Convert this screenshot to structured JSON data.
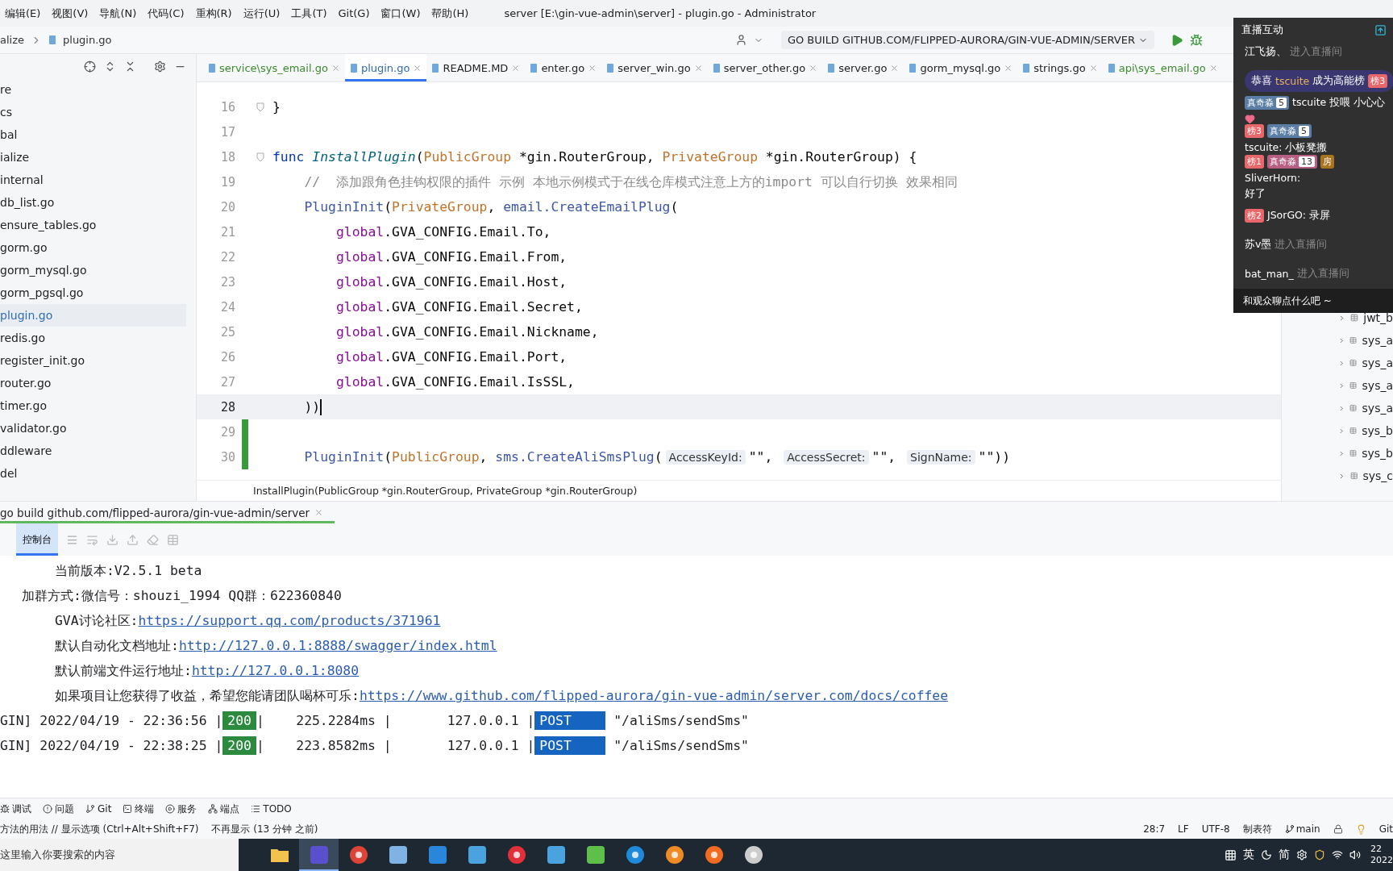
{
  "menu": [
    "编辑(E)",
    "视图(V)",
    "导航(N)",
    "代码(C)",
    "重构(R)",
    "运行(U)",
    "工具(T)",
    "Git(G)",
    "窗口(W)",
    "帮助(H)"
  ],
  "window": {
    "title": "server [E:\\gin-vue-admin\\server] - plugin.go - Administrator"
  },
  "breadcrumb": [
    "alize",
    "plugin.go"
  ],
  "run_config": "GO BUILD GITHUB.COM/FLIPPED-AURORA/GIN-VUE-ADMIN/SERVER",
  "project_tree": [
    {
      "label": "re",
      "selected": false
    },
    {
      "label": "cs",
      "selected": false
    },
    {
      "label": "bal",
      "selected": false
    },
    {
      "label": "ialize",
      "selected": false
    },
    {
      "label": "internal",
      "selected": false
    },
    {
      "label": "db_list.go",
      "selected": false
    },
    {
      "label": "ensure_tables.go",
      "selected": false
    },
    {
      "label": "gorm.go",
      "selected": false
    },
    {
      "label": "gorm_mysql.go",
      "selected": false
    },
    {
      "label": "gorm_pgsql.go",
      "selected": false
    },
    {
      "label": "plugin.go",
      "selected": true
    },
    {
      "label": "redis.go",
      "selected": false
    },
    {
      "label": "register_init.go",
      "selected": false
    },
    {
      "label": "router.go",
      "selected": false
    },
    {
      "label": "timer.go",
      "selected": false
    },
    {
      "label": "validator.go",
      "selected": false
    },
    {
      "label": "ddleware",
      "selected": false
    },
    {
      "label": "del",
      "selected": false
    }
  ],
  "editor_tabs": [
    {
      "label": "service\\sys_email.go",
      "selected": false,
      "modified": true
    },
    {
      "label": "plugin.go",
      "selected": true,
      "modified": false
    },
    {
      "label": "README.MD",
      "selected": false,
      "modified": false
    },
    {
      "label": "enter.go",
      "selected": false,
      "modified": false
    },
    {
      "label": "server_win.go",
      "selected": false,
      "modified": false
    },
    {
      "label": "server_other.go",
      "selected": false,
      "modified": false
    },
    {
      "label": "server.go",
      "selected": false,
      "modified": false
    },
    {
      "label": "gorm_mysql.go",
      "selected": false,
      "modified": false
    },
    {
      "label": "strings.go",
      "selected": false,
      "modified": false
    },
    {
      "label": "api\\sys_email.go",
      "selected": false,
      "modified": true
    }
  ],
  "code_lines": [
    {
      "number": "16",
      "current": false,
      "changed": false,
      "fold": true,
      "tokens": [
        {
          "kind": "plain",
          "text": "}"
        }
      ]
    },
    {
      "number": "17",
      "current": false,
      "changed": false,
      "fold": false
    },
    {
      "number": "18",
      "current": false,
      "changed": false,
      "fold": true,
      "tokens": [
        {
          "kind": "keyword",
          "text": "func "
        },
        {
          "kind": "declaration",
          "text": "InstallPlugin"
        },
        {
          "kind": "plain",
          "text": "("
        },
        {
          "kind": "param",
          "text": "PublicGroup"
        },
        {
          "kind": "plain",
          "text": " *gin.RouterGroup, "
        },
        {
          "kind": "param",
          "text": "PrivateGroup"
        },
        {
          "kind": "plain",
          "text": " *gin.RouterGroup) {"
        }
      ]
    },
    {
      "number": "19",
      "current": false,
      "changed": false,
      "fold": false,
      "tokens": [
        {
          "kind": "comment",
          "text": "    //  添加跟角色挂钩权限的插件 示例 本地示例模式于在线仓库模式注意上方的import 可以自行切换 效果相同"
        }
      ]
    },
    {
      "number": "20",
      "current": false,
      "changed": false,
      "fold": false,
      "tokens": [
        {
          "kind": "call",
          "text": "    PluginInit"
        },
        {
          "kind": "plain",
          "text": "("
        },
        {
          "kind": "param",
          "text": "PrivateGroup"
        },
        {
          "kind": "plain",
          "text": ", "
        },
        {
          "kind": "call",
          "text": "email.CreateEmailPlug"
        },
        {
          "kind": "plain",
          "text": "("
        }
      ]
    },
    {
      "number": "21",
      "current": false,
      "changed": false,
      "fold": false,
      "tokens": [
        {
          "kind": "global",
          "text": "        global"
        },
        {
          "kind": "plain",
          "text": ".GVA_CONFIG.Email.To,"
        }
      ]
    },
    {
      "number": "22",
      "current": false,
      "changed": false,
      "fold": false,
      "tokens": [
        {
          "kind": "global",
          "text": "        global"
        },
        {
          "kind": "plain",
          "text": ".GVA_CONFIG.Email.From,"
        }
      ]
    },
    {
      "number": "23",
      "current": false,
      "changed": false,
      "fold": false,
      "tokens": [
        {
          "kind": "global",
          "text": "        global"
        },
        {
          "kind": "plain",
          "text": ".GVA_CONFIG.Email.Host,"
        }
      ]
    },
    {
      "number": "24",
      "current": false,
      "changed": false,
      "fold": false,
      "tokens": [
        {
          "kind": "global",
          "text": "        global"
        },
        {
          "kind": "plain",
          "text": ".GVA_CONFIG.Email.Secret,"
        }
      ]
    },
    {
      "number": "25",
      "current": false,
      "changed": false,
      "fold": false,
      "tokens": [
        {
          "kind": "global",
          "text": "        global"
        },
        {
          "kind": "plain",
          "text": ".GVA_CONFIG.Email.Nickname,"
        }
      ]
    },
    {
      "number": "26",
      "current": false,
      "changed": false,
      "fold": false,
      "tokens": [
        {
          "kind": "global",
          "text": "        global"
        },
        {
          "kind": "plain",
          "text": ".GVA_CONFIG.Email.Port,"
        }
      ]
    },
    {
      "number": "27",
      "current": false,
      "changed": false,
      "fold": false,
      "tokens": [
        {
          "kind": "global",
          "text": "        global"
        },
        {
          "kind": "plain",
          "text": ".GVA_CONFIG.Email.IsSSL,"
        }
      ]
    },
    {
      "number": "28",
      "current": true,
      "changed": false,
      "fold": false,
      "tokens": [
        {
          "kind": "plain",
          "text": "    ))"
        }
      ]
    },
    {
      "number": "29",
      "current": false,
      "changed": true,
      "fold": false
    },
    {
      "number": "30",
      "current": false,
      "changed": true,
      "fold": false,
      "tokens": [
        {
          "kind": "call",
          "text": "    PluginInit"
        },
        {
          "kind": "plain",
          "text": "("
        },
        {
          "kind": "param",
          "text": "PublicGroup"
        },
        {
          "kind": "plain",
          "text": ", "
        },
        {
          "kind": "call",
          "text": "sms.CreateAliSmsPlug"
        },
        {
          "kind": "plain",
          "text": "("
        },
        {
          "kind": "hint",
          "text": "AccessKeyId:"
        },
        {
          "kind": "plain",
          "text": "\"\", "
        },
        {
          "kind": "hint",
          "text": "AccessSecret:"
        },
        {
          "kind": "plain",
          "text": "\"\", "
        },
        {
          "kind": "hint",
          "text": "SignName:"
        },
        {
          "kind": "plain",
          "text": "\"\"))"
        }
      ]
    }
  ],
  "signature_hint": "InstallPlugin(PublicGroup *gin.RouterGroup, PrivateGroup *gin.RouterGroup)",
  "database_tables": [
    "jwt_b",
    "sys_a",
    "sys_a",
    "sys_a",
    "sys_a",
    "sys_b",
    "sys_b",
    "sys_c"
  ],
  "live_chat": {
    "title": "直播互动",
    "footer": "和观众聊点什么吧 ~",
    "messages": [
      {
        "kind": "enter",
        "user": "江飞扬、",
        "text": "进入直播间"
      },
      {
        "kind": "banner",
        "before": "恭喜",
        "user": "tscuite",
        "text": "成为高能榜",
        "badges": [
          {
            "label": "榜3",
            "color": "#e8676b"
          }
        ]
      },
      {
        "kind": "chat",
        "badges": [
          {
            "label": "真奇淼",
            "color": "#5b7ea6",
            "level": "5"
          }
        ],
        "text": "tscuite 投喂 小心心",
        "heart": true
      },
      {
        "kind": "chat",
        "badges": [
          {
            "label": "榜3",
            "color": "#e8676b"
          },
          {
            "label": "真奇淼",
            "color": "#5b7ea6",
            "level": "5"
          }
        ],
        "text": "tscuite: 小板凳搬",
        "heart": false
      },
      {
        "kind": "chat",
        "badges": [
          {
            "label": "榜1",
            "color": "#e8676b"
          },
          {
            "label": "真奇淼",
            "color": "#b65f82",
            "level": "13"
          },
          {
            "label": "房",
            "color": "#a8741f"
          }
        ],
        "text": "SliverHorn:",
        "more": "好了",
        "heart": false
      },
      {
        "kind": "chat",
        "badges": [
          {
            "label": "榜2",
            "color": "#e8676b"
          }
        ],
        "text": "JSorGO: 录屏",
        "heart": false
      },
      {
        "kind": "enter",
        "user": "苏v墨",
        "text": "进入直播间"
      },
      {
        "kind": "enter",
        "user": "bat_man_",
        "text": "进入直播间"
      }
    ]
  },
  "run_tab": "go build github.com/flipped-aurora/gin-vue-admin/server",
  "console_tabs": [
    {
      "label": "控制台",
      "selected": true
    }
  ],
  "console_lines": [
    {
      "kind": "info",
      "indented": true,
      "text": "当前版本:V2.5.1 beta"
    },
    {
      "kind": "info",
      "indented": false,
      "text": "加群方式:微信号：shouzi_1994 QQ群：622360840"
    },
    {
      "kind": "info",
      "indented": true,
      "text": "GVA讨论社区:",
      "link": "https://support.qq.com/products/371961"
    },
    {
      "kind": "info",
      "indented": true,
      "text": "默认自动化文档地址:",
      "link": "http://127.0.0.1:8888/swagger/index.html"
    },
    {
      "kind": "info",
      "indented": true,
      "text": "默认前端文件运行地址:",
      "link": "http://127.0.0.1:8080"
    },
    {
      "kind": "info",
      "indented": true,
      "text": "如果项目让您获得了收益，希望您能请团队喝杯可乐:",
      "link": "https://www.github.com/flipped-aurora/gin-vue-admin/server.com/docs/coffee"
    },
    {
      "kind": "log",
      "prefix": "GIN] 2022/04/19 - 22:36:56 |",
      "status": "200",
      "middle": "|    225.2284ms |       127.0.0.1 |",
      "method": "POST",
      "path": "\"/aliSms/sendSms\""
    },
    {
      "kind": "log",
      "prefix": "GIN] 2022/04/19 - 22:38:25 |",
      "status": "200",
      "middle": "|    223.8582ms |       127.0.0.1 |",
      "method": "POST",
      "path": "\"/aliSms/sendSms\""
    }
  ],
  "tool_windows": [
    {
      "kind": "debug",
      "label": "调试"
    },
    {
      "kind": "problems",
      "label": "问题"
    },
    {
      "kind": "git",
      "label": "Git"
    },
    {
      "kind": "terminal",
      "label": "终端"
    },
    {
      "kind": "services",
      "label": "服务"
    },
    {
      "kind": "endpoints",
      "label": "端点"
    },
    {
      "kind": "todo",
      "label": "TODO"
    }
  ],
  "status_bar": {
    "message": "方法的用法 // 显示选项 (Ctrl+Alt+Shift+F7)",
    "dismiss": "不再显示 (13 分钟 之前)",
    "position": "28:7",
    "line_ending": "LF",
    "encoding": "UTF-8",
    "indent": "制表符",
    "branch": "main",
    "cut": "Git"
  },
  "taskbar": {
    "search_placeholder": "这里输入你要搜索的内容",
    "apps": [
      {
        "kind": "folder",
        "selected": false
      },
      {
        "kind": "goland",
        "selected": true
      },
      {
        "kind": "chrome",
        "selected": false
      },
      {
        "kind": "notepad",
        "selected": false
      },
      {
        "kind": "vscode",
        "selected": false
      },
      {
        "kind": "app",
        "selected": false
      },
      {
        "kind": "music",
        "selected": false
      },
      {
        "kind": "app",
        "selected": false
      },
      {
        "kind": "game",
        "selected": false
      },
      {
        "kind": "edge",
        "selected": false
      },
      {
        "kind": "ring",
        "selected": false
      },
      {
        "kind": "compass",
        "selected": false
      },
      {
        "kind": "obs",
        "selected": false
      }
    ],
    "tray_texts": [
      "英",
      "简"
    ],
    "clock": [
      "22",
      "2022"
    ]
  }
}
